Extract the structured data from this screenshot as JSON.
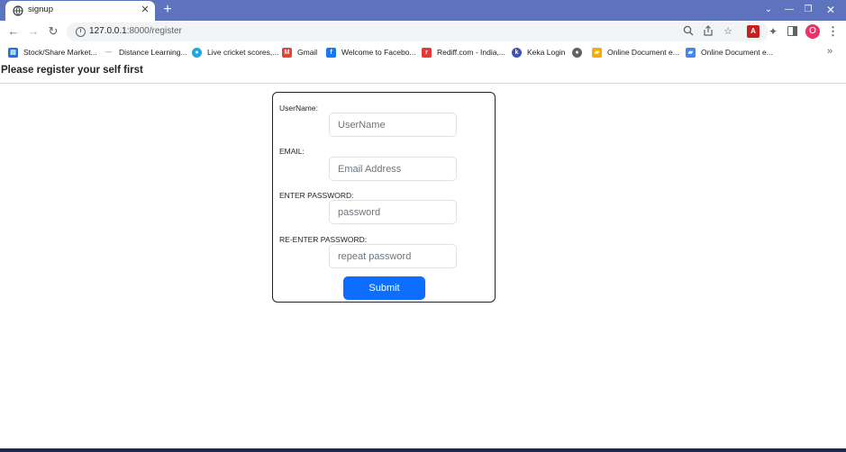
{
  "browser": {
    "tab": {
      "title": "signup",
      "favicon": "globe-icon",
      "close": "✕"
    },
    "new_tab": "+",
    "window_controls": {
      "chevron": "⌄",
      "minimize": "—",
      "maximize": "❐",
      "close": "✕"
    },
    "nav": {
      "back": "←",
      "forward": "→",
      "reload": "↻"
    },
    "address": {
      "host": "127.0.0.1",
      "path": ":8000/register"
    },
    "omnibox_icons": [
      "zoom-icon",
      "share-icon",
      "star-icon"
    ],
    "extensions": [
      "pdf-extension-icon",
      "puzzle-icon",
      "side-panel-icon"
    ],
    "profile_initial": "O",
    "profile_color": "#e8336b",
    "tabstrip_color": "#5d73bd"
  },
  "bookmarks": [
    {
      "label": "Stock/Share Market...",
      "icon": "chart-icon",
      "color": "#1a73e8"
    },
    {
      "label": "Distance Learning...",
      "icon": "dash-icon",
      "color": "#9aa0a6"
    },
    {
      "label": "Live cricket scores,...",
      "icon": "globe-icon",
      "color": "#1ea7e1"
    },
    {
      "label": "Gmail",
      "icon": "gmail-icon",
      "color": "#ea4335"
    },
    {
      "label": "Welcome to Facebo...",
      "icon": "facebook-icon",
      "color": "#1877f2"
    },
    {
      "label": "Rediff.com - India,...",
      "icon": "rediff-icon",
      "color": "#e53935"
    },
    {
      "label": "Keka Login",
      "icon": "keka-icon",
      "color": "#3f51b5"
    },
    {
      "label": "",
      "icon": "globe-icon",
      "color": "#5f6368"
    },
    {
      "label": "Online Document e...",
      "icon": "document-icon",
      "color": "#f9ab00"
    },
    {
      "label": "Online Document e...",
      "icon": "document-icon",
      "color": "#4285f4"
    }
  ],
  "bookmarks_more": "»",
  "page": {
    "heading": "Please register your self first",
    "form": {
      "username_label": "UserName:",
      "username_placeholder": "UserName",
      "email_label": "EMAIL:",
      "email_placeholder": "Email Address",
      "password_label": "ENTER PASSWORD:",
      "password_placeholder": "password",
      "repassword_label": "RE-ENTER PASSWORD:",
      "repassword_placeholder": "repeat password",
      "submit_label": "Submit"
    },
    "accent_color": "#0d6efd"
  }
}
